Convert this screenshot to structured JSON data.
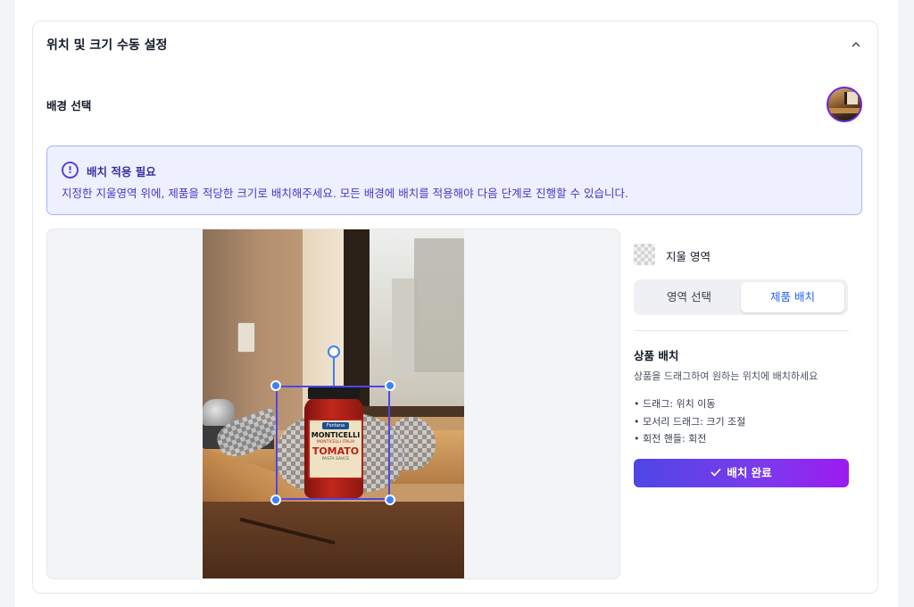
{
  "section": {
    "title": "위치 및 크기 수동 설정",
    "collapse_icon": "chevron-up-icon"
  },
  "background": {
    "label": "배경 선택"
  },
  "alert": {
    "icon": "exclamation-circle-icon",
    "icon_glyph": "!",
    "title": "배치 적용 필요",
    "message": "지정한 지울영역 위에, 제품을 적당한 크기로 배치해주세요. 모든 배경에 배치를 적용해야 다음 단계로 진행할 수 있습니다."
  },
  "product": {
    "badge": "Fontana",
    "brand": "MONTICELLI",
    "sub": "MONTICELLI ITALIA",
    "flavor": "TOMATO",
    "small": "PASTA SAUCE"
  },
  "panel": {
    "erase_area_label": "지울 영역",
    "tabs": [
      {
        "label": "영역 선택",
        "active": false
      },
      {
        "label": "제품 배치",
        "active": true
      }
    ],
    "placement_title": "상품 배치",
    "placement_desc": "상품을 드래그하여 원하는 위치에 배치하세요",
    "tips": [
      "• 드래그: 위치 이동",
      "• 모서리 드래그: 크기 조절",
      "• 회전 핸들: 회전"
    ],
    "done_button": "배치 완료",
    "done_icon": "check-icon"
  },
  "colors": {
    "accent": "#4f46e5",
    "handle": "#3b82f6",
    "alert_bg": "#eef0ff",
    "tab_active_text": "#2563eb"
  }
}
